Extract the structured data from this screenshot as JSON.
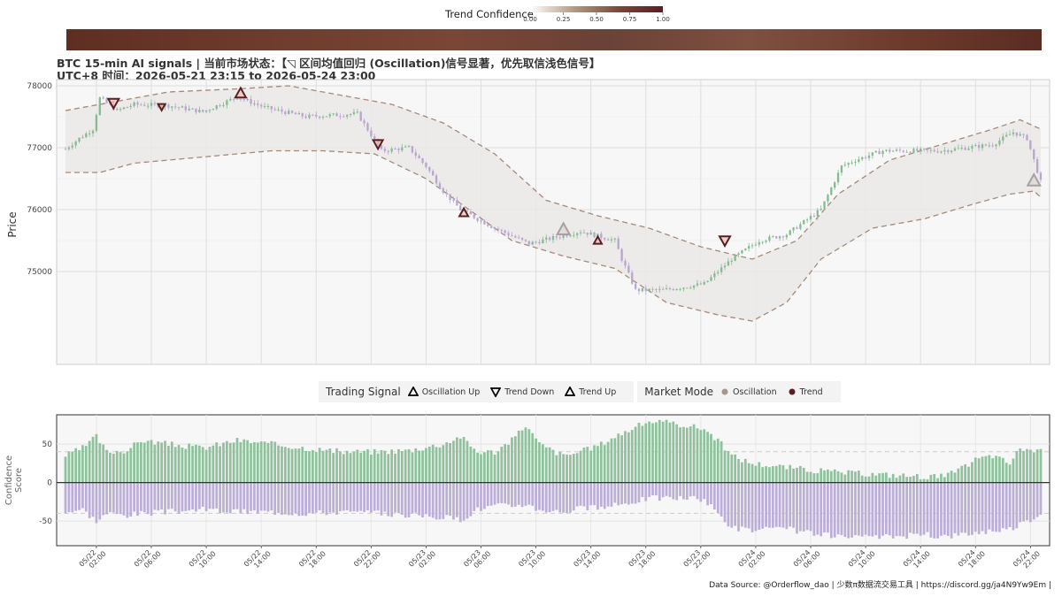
{
  "title": {
    "line1": "BTC 15-min AI signals | 当前市场状态：【◹ 区间均值回归 (Oscillation)信号显著，优先取信浅色信号】",
    "line2": "UTC+8 时间：2026-05-21 23:15 to 2026-05-24 23:00"
  },
  "colorbar": {
    "title": "Trend Confidence",
    "ticks": [
      "0.00",
      "0.25",
      "0.50",
      "0.75",
      "1.00"
    ],
    "colors": [
      "#ffffff",
      "#b49a82",
      "#7a4a3a",
      "#5a1e22"
    ]
  },
  "legend": {
    "signal_title": "Trading Signal",
    "signal_items": [
      "Oscillation Up",
      "Trend Down",
      "Trend Up"
    ],
    "mode_title": "Market Mode",
    "mode_items": [
      "Oscillation",
      "Trend"
    ],
    "mode_colors": [
      "#a8968a",
      "#5a1e22"
    ]
  },
  "source": "Data Source: @Orderflow_dao | 少数π数据流交易工具 | https://discord.gg/ja4N9Yw9Em |",
  "colors": {
    "bull": "#86bb92",
    "bear": "#b9a6cf",
    "band_fill": "#ebe8e8",
    "band_line": "#a58a78",
    "trend_marker": "#5a1e22",
    "osc_marker": "#a8a0a0",
    "conf_pos": "#8fc19c",
    "conf_neg": "#bcaed6"
  },
  "chart_data": [
    {
      "type": "candlestick",
      "ylabel": "Price",
      "ylim": [
        73500,
        78100
      ],
      "yticks": [
        75000,
        76000,
        77000,
        78000
      ],
      "xlim": [
        0,
        284
      ],
      "x_tick_positions": [
        9,
        25,
        41,
        57,
        73,
        89,
        105,
        121,
        137,
        153,
        169,
        185,
        201,
        217,
        233,
        249,
        265,
        281
      ],
      "x_tick_labels": [
        "05/22\n02:00",
        "05/22\n06:00",
        "05/22\n10:00",
        "05/22\n14:00",
        "05/22\n18:00",
        "05/22\n22:00",
        "05/23\n02:00",
        "05/23\n06:00",
        "05/23\n10:00",
        "05/23\n14:00",
        "05/23\n18:00",
        "05/23\n22:00",
        "05/24\n02:00",
        "05/24\n06:00",
        "05/24\n10:00",
        "05/24\n14:00",
        "05/24\n18:00",
        "05/24\n22:00"
      ],
      "price_anchors": [
        [
          0,
          76980
        ],
        [
          4,
          77150
        ],
        [
          8,
          77300
        ],
        [
          10,
          77800
        ],
        [
          15,
          77600
        ],
        [
          20,
          77700
        ],
        [
          30,
          77680
        ],
        [
          40,
          77580
        ],
        [
          50,
          77820
        ],
        [
          58,
          77650
        ],
        [
          70,
          77500
        ],
        [
          85,
          77550
        ],
        [
          92,
          76950
        ],
        [
          100,
          77000
        ],
        [
          105,
          76700
        ],
        [
          110,
          76300
        ],
        [
          115,
          76000
        ],
        [
          125,
          75700
        ],
        [
          135,
          75450
        ],
        [
          150,
          75650
        ],
        [
          160,
          75500
        ],
        [
          162,
          75200
        ],
        [
          166,
          74700
        ],
        [
          174,
          74700
        ],
        [
          186,
          74800
        ],
        [
          194,
          75200
        ],
        [
          202,
          75500
        ],
        [
          210,
          75600
        ],
        [
          220,
          76000
        ],
        [
          226,
          76700
        ],
        [
          230,
          76800
        ],
        [
          238,
          76950
        ],
        [
          255,
          76950
        ],
        [
          270,
          77050
        ],
        [
          276,
          77250
        ],
        [
          280,
          77150
        ],
        [
          284,
          76450
        ]
      ],
      "band_upper": [
        [
          0,
          77600
        ],
        [
          10,
          77700
        ],
        [
          30,
          77900
        ],
        [
          50,
          77950
        ],
        [
          65,
          78000
        ],
        [
          80,
          77850
        ],
        [
          95,
          77700
        ],
        [
          110,
          77400
        ],
        [
          125,
          76900
        ],
        [
          140,
          76150
        ],
        [
          155,
          75900
        ],
        [
          170,
          75700
        ],
        [
          185,
          75400
        ],
        [
          200,
          75200
        ],
        [
          213,
          75500
        ],
        [
          225,
          76250
        ],
        [
          240,
          76800
        ],
        [
          255,
          77050
        ],
        [
          270,
          77300
        ],
        [
          278,
          77450
        ],
        [
          284,
          77300
        ]
      ],
      "band_lower": [
        [
          0,
          76600
        ],
        [
          10,
          76600
        ],
        [
          20,
          76750
        ],
        [
          40,
          76850
        ],
        [
          60,
          76950
        ],
        [
          75,
          76950
        ],
        [
          90,
          76900
        ],
        [
          105,
          76500
        ],
        [
          120,
          75900
        ],
        [
          130,
          75500
        ],
        [
          145,
          75250
        ],
        [
          160,
          75050
        ],
        [
          175,
          74500
        ],
        [
          190,
          74300
        ],
        [
          200,
          74200
        ],
        [
          210,
          74500
        ],
        [
          220,
          75200
        ],
        [
          235,
          75700
        ],
        [
          250,
          75850
        ],
        [
          265,
          76100
        ],
        [
          275,
          76250
        ],
        [
          282,
          76300
        ],
        [
          284,
          76200
        ]
      ],
      "signals": [
        {
          "x": 14,
          "price": 77720,
          "kind": "Trend Down",
          "color": "#5a1e22",
          "size": 12
        },
        {
          "x": 28,
          "price": 77660,
          "kind": "Trend Down",
          "color": "#5a1e22",
          "size": 8
        },
        {
          "x": 51,
          "price": 77880,
          "kind": "Trend Up",
          "color": "#5a1e22",
          "size": 12
        },
        {
          "x": 91,
          "price": 77060,
          "kind": "Trend Down",
          "color": "#5a1e22",
          "size": 11
        },
        {
          "x": 116,
          "price": 75950,
          "kind": "Trend Up",
          "color": "#5a1e22",
          "size": 10
        },
        {
          "x": 145,
          "price": 75680,
          "kind": "Oscillation Up",
          "color": "#a8a0a0",
          "size": 14
        },
        {
          "x": 155,
          "price": 75500,
          "kind": "Trend Up",
          "color": "#5a1e22",
          "size": 9
        },
        {
          "x": 192,
          "price": 75500,
          "kind": "Trend Down",
          "color": "#5a1e22",
          "size": 12
        },
        {
          "x": 282,
          "price": 76470,
          "kind": "Oscillation Up",
          "color": "#a8a0a0",
          "size": 14
        }
      ]
    },
    {
      "type": "bar",
      "ylabel": "Confidence\nScore",
      "ylim": [
        -82,
        88
      ],
      "yticks": [
        -50,
        0,
        50
      ],
      "xlim": [
        0,
        284
      ],
      "pos_anchors": [
        [
          0,
          35
        ],
        [
          5,
          45
        ],
        [
          9,
          60
        ],
        [
          12,
          40
        ],
        [
          18,
          42
        ],
        [
          22,
          55
        ],
        [
          30,
          50
        ],
        [
          40,
          45
        ],
        [
          50,
          55
        ],
        [
          60,
          50
        ],
        [
          70,
          45
        ],
        [
          80,
          40
        ],
        [
          90,
          40
        ],
        [
          100,
          42
        ],
        [
          110,
          50
        ],
        [
          115,
          60
        ],
        [
          120,
          40
        ],
        [
          125,
          40
        ],
        [
          130,
          55
        ],
        [
          134,
          75
        ],
        [
          138,
          50
        ],
        [
          145,
          35
        ],
        [
          150,
          40
        ],
        [
          156,
          50
        ],
        [
          160,
          60
        ],
        [
          165,
          70
        ],
        [
          170,
          80
        ],
        [
          180,
          75
        ],
        [
          186,
          70
        ],
        [
          190,
          55
        ],
        [
          194,
          35
        ],
        [
          200,
          25
        ],
        [
          210,
          20
        ],
        [
          220,
          15
        ],
        [
          230,
          12
        ],
        [
          240,
          10
        ],
        [
          250,
          8
        ],
        [
          255,
          8
        ],
        [
          260,
          15
        ],
        [
          265,
          30
        ],
        [
          270,
          35
        ],
        [
          275,
          25
        ],
        [
          278,
          45
        ],
        [
          284,
          40
        ]
      ],
      "neg_anchors": [
        [
          0,
          -38
        ],
        [
          5,
          -35
        ],
        [
          9,
          -50
        ],
        [
          12,
          -40
        ],
        [
          18,
          -42
        ],
        [
          22,
          -40
        ],
        [
          30,
          -38
        ],
        [
          40,
          -35
        ],
        [
          50,
          -38
        ],
        [
          60,
          -38
        ],
        [
          70,
          -40
        ],
        [
          80,
          -38
        ],
        [
          90,
          -40
        ],
        [
          100,
          -42
        ],
        [
          110,
          -45
        ],
        [
          115,
          -48
        ],
        [
          120,
          -35
        ],
        [
          125,
          -30
        ],
        [
          130,
          -30
        ],
        [
          134,
          -28
        ],
        [
          138,
          -35
        ],
        [
          145,
          -38
        ],
        [
          150,
          -33
        ],
        [
          156,
          -33
        ],
        [
          160,
          -30
        ],
        [
          165,
          -25
        ],
        [
          170,
          -20
        ],
        [
          180,
          -20
        ],
        [
          186,
          -22
        ],
        [
          190,
          -40
        ],
        [
          194,
          -58
        ],
        [
          200,
          -62
        ],
        [
          210,
          -60
        ],
        [
          220,
          -68
        ],
        [
          230,
          -72
        ],
        [
          240,
          -70
        ],
        [
          250,
          -68
        ],
        [
          255,
          -70
        ],
        [
          260,
          -68
        ],
        [
          265,
          -65
        ],
        [
          270,
          -62
        ],
        [
          275,
          -60
        ],
        [
          278,
          -55
        ],
        [
          284,
          -40
        ]
      ],
      "dashed_refs": [
        40,
        -40
      ]
    }
  ]
}
